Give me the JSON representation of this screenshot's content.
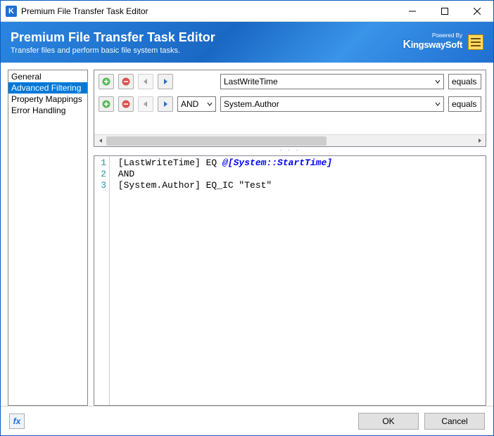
{
  "window": {
    "title": "Premium File Transfer Task Editor"
  },
  "banner": {
    "title": "Premium File Transfer Task Editor",
    "subtitle": "Transfer files and perform basic file system tasks.",
    "powered_by_label": "Powered By",
    "brand_k": "K",
    "brand_rest": "ingswaySoft"
  },
  "sidebar": {
    "items": [
      {
        "label": "General",
        "selected": false
      },
      {
        "label": "Advanced Filtering",
        "selected": true
      },
      {
        "label": "Property Mappings",
        "selected": false
      },
      {
        "label": "Error Handling",
        "selected": false
      }
    ]
  },
  "filters": {
    "rows": [
      {
        "logic": "",
        "field": "LastWriteTime",
        "operator": "equals"
      },
      {
        "logic": "AND",
        "field": "System.Author",
        "operator": "equals"
      }
    ]
  },
  "editor": {
    "lines": [
      {
        "n": "1",
        "segments": [
          {
            "t": " [LastWriteTime] EQ ",
            "c": "tok-field"
          },
          {
            "t": "@[System::StartTime]",
            "c": "tok-var"
          }
        ]
      },
      {
        "n": "2",
        "segments": [
          {
            "t": " AND",
            "c": "tok-field"
          }
        ]
      },
      {
        "n": "3",
        "segments": [
          {
            "t": " [System.Author] EQ_IC \"Test\"",
            "c": "tok-field"
          }
        ]
      }
    ]
  },
  "footer": {
    "fx": "fx",
    "ok": "OK",
    "cancel": "Cancel"
  }
}
